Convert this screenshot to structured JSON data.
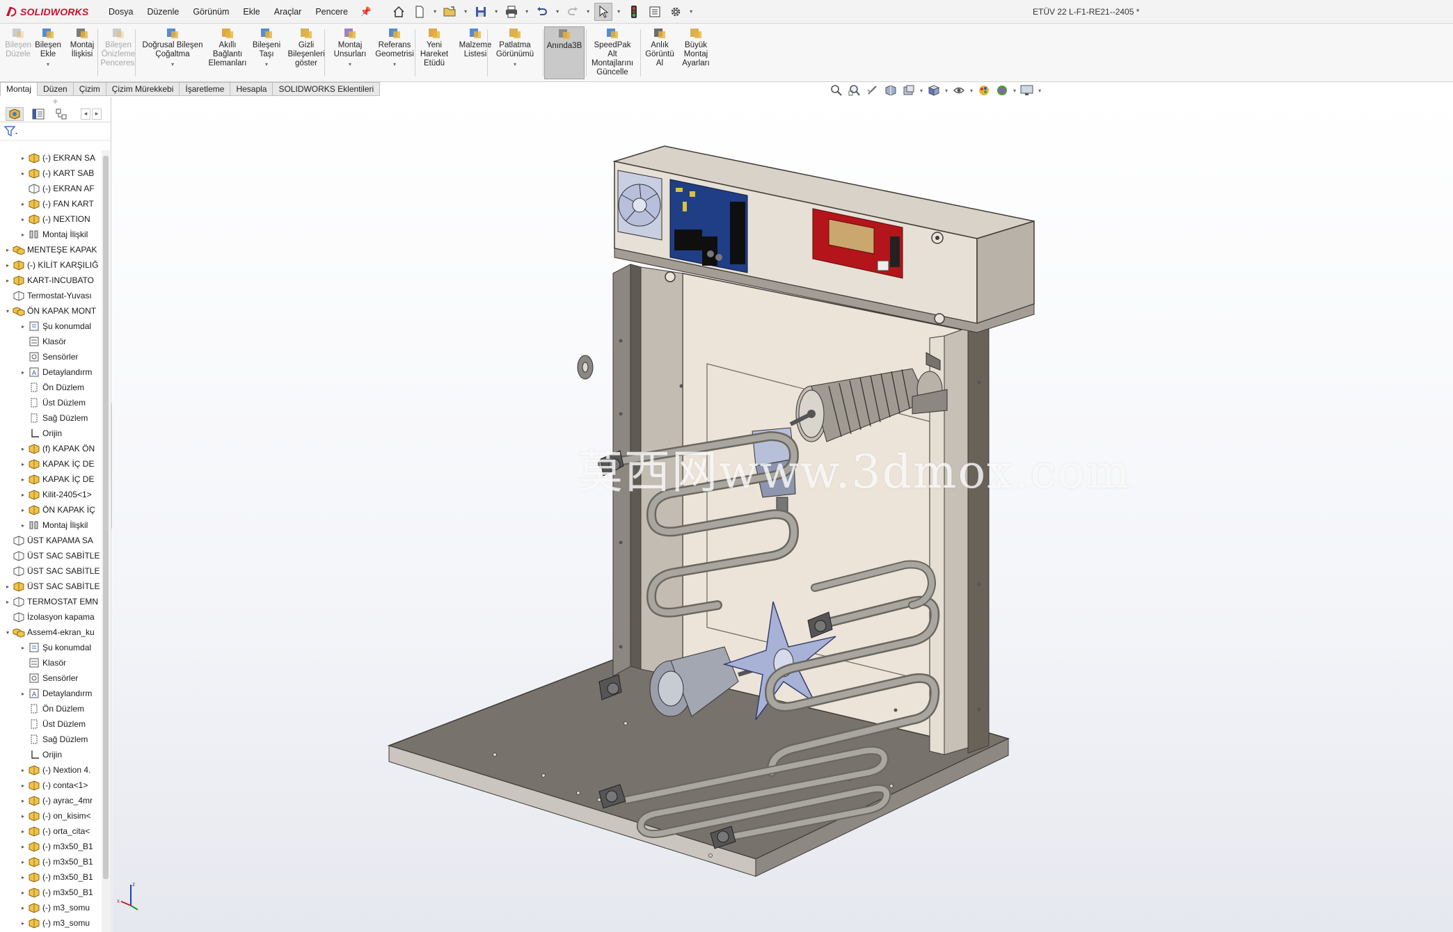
{
  "app": {
    "brand": "SOLIDWORKS",
    "document_title": "ETÜV 22 L-F1-RE21--2405 *"
  },
  "menu": [
    "Dosya",
    "Düzenle",
    "Görünüm",
    "Ekle",
    "Araçlar",
    "Pencere"
  ],
  "quick_toolbar": [
    "home-icon",
    "new-document-icon",
    "open-icon",
    "save-icon",
    "print-icon",
    "undo-icon",
    "redo-icon",
    "select-icon",
    "traffic-light-icon",
    "file-properties-icon",
    "options-gear-icon"
  ],
  "ribbon": {
    "buttons": [
      {
        "label": "Bileşen\nDüzele",
        "state": "disabled"
      },
      {
        "label": "Bileşen\nEkle",
        "state": "enabled",
        "dropdown": true
      },
      {
        "label": "Montaj\nİlişkisi",
        "state": "enabled"
      },
      {
        "label": "Bileşen\nÖnizleme\nPenceresi",
        "state": "disabled"
      },
      {
        "label": "Doğrusal Bileşen\nÇoğaltma",
        "state": "enabled",
        "dropdown": true
      },
      {
        "label": "Akıllı\nBağlantı\nElemanları",
        "state": "enabled"
      },
      {
        "label": "Bileşeni\nTaşı",
        "state": "enabled",
        "dropdown": true
      },
      {
        "label": "Gizli\nBileşenleri\ngöster",
        "state": "enabled"
      },
      {
        "label": "Montaj\nUnsurları",
        "state": "enabled",
        "dropdown": true
      },
      {
        "label": "Referans\nGeometrisi",
        "state": "enabled",
        "dropdown": true
      },
      {
        "label": "Yeni\nHareket\nEtüdü",
        "state": "enabled"
      },
      {
        "label": "Malzeme\nListesi",
        "state": "enabled"
      },
      {
        "label": "Patlatma\nGörünümü",
        "state": "enabled",
        "dropdown": true
      },
      {
        "label": "Anında3B",
        "state": "active"
      },
      {
        "label": "SpeedPak\nAlt\nMontajlarını\nGüncelle",
        "state": "enabled"
      },
      {
        "label": "Anlık\nGörüntü\nAl",
        "state": "enabled"
      },
      {
        "label": "Büyük\nMontaj\nAyarları",
        "state": "enabled"
      }
    ]
  },
  "tabs": [
    "Montaj",
    "Düzen",
    "Çizim",
    "Çizim Mürekkebi",
    "İşaretleme",
    "Hesapla",
    "SOLIDWORKS Eklentileri"
  ],
  "active_tab": "Montaj",
  "feature_tree": {
    "nodes": [
      {
        "label": "(-) EKRAN SA",
        "indent": 1,
        "expand": "collapsed",
        "icon": "part"
      },
      {
        "label": "(-) KART SAB",
        "indent": 1,
        "expand": "collapsed",
        "icon": "part"
      },
      {
        "label": "(-) EKRAN AF",
        "indent": 1,
        "expand": "none",
        "icon": "part-outline"
      },
      {
        "label": "(-) FAN KART",
        "indent": 1,
        "expand": "collapsed",
        "icon": "part"
      },
      {
        "label": "(-) NEXTION",
        "indent": 1,
        "expand": "collapsed",
        "icon": "part"
      },
      {
        "label": "Montaj İlişkil",
        "indent": 1,
        "expand": "collapsed",
        "icon": "mates"
      },
      {
        "label": "MENTEŞE KAPAK",
        "indent": 0,
        "expand": "collapsed",
        "icon": "assembly"
      },
      {
        "label": "(-) KİLİT KARŞILIĞ",
        "indent": 0,
        "expand": "collapsed",
        "icon": "part"
      },
      {
        "label": "KART-INCUBATO",
        "indent": 0,
        "expand": "collapsed",
        "icon": "part"
      },
      {
        "label": "Termostat-Yuvası",
        "indent": 0,
        "expand": "none",
        "icon": "part-outline"
      },
      {
        "label": "ÖN KAPAK MONT",
        "indent": 0,
        "expand": "expanded",
        "icon": "assembly"
      },
      {
        "label": "Şu konumdal",
        "indent": 1,
        "expand": "collapsed",
        "icon": "history"
      },
      {
        "label": "Klasör",
        "indent": 1,
        "expand": "none",
        "icon": "folder"
      },
      {
        "label": "Sensörler",
        "indent": 1,
        "expand": "none",
        "icon": "sensor"
      },
      {
        "label": "Detaylandırm",
        "indent": 1,
        "expand": "collapsed",
        "icon": "annotation"
      },
      {
        "label": "Ön Düzlem",
        "indent": 1,
        "expand": "none",
        "icon": "plane"
      },
      {
        "label": "Üst Düzlem",
        "indent": 1,
        "expand": "none",
        "icon": "plane"
      },
      {
        "label": "Sağ Düzlem",
        "indent": 1,
        "expand": "none",
        "icon": "plane"
      },
      {
        "label": "Orijin",
        "indent": 1,
        "expand": "none",
        "icon": "origin"
      },
      {
        "label": "(f) KAPAK ÖN",
        "indent": 1,
        "expand": "collapsed",
        "icon": "part"
      },
      {
        "label": "KAPAK İÇ DE",
        "indent": 1,
        "expand": "collapsed",
        "icon": "part"
      },
      {
        "label": "KAPAK İÇ DE",
        "indent": 1,
        "expand": "collapsed",
        "icon": "part"
      },
      {
        "label": "Kilit-2405<1>",
        "indent": 1,
        "expand": "collapsed",
        "icon": "part"
      },
      {
        "label": "ÖN KAPAK İÇ",
        "indent": 1,
        "expand": "collapsed",
        "icon": "part"
      },
      {
        "label": "Montaj İlişkil",
        "indent": 1,
        "expand": "collapsed",
        "icon": "mates"
      },
      {
        "label": "ÜST KAPAMA SA",
        "indent": 0,
        "expand": "none",
        "icon": "part-outline"
      },
      {
        "label": "ÜST SAC SABİTLE",
        "indent": 0,
        "expand": "none",
        "icon": "part-outline"
      },
      {
        "label": "ÜST SAC SABİTLE",
        "indent": 0,
        "expand": "none",
        "icon": "part-outline"
      },
      {
        "label": "ÜST SAC SABİTLE",
        "indent": 0,
        "expand": "collapsed",
        "icon": "part"
      },
      {
        "label": "TERMOSTAT EMN",
        "indent": 0,
        "expand": "collapsed",
        "icon": "part-outline"
      },
      {
        "label": "İzolasyon kapama",
        "indent": 0,
        "expand": "none",
        "icon": "part-outline"
      },
      {
        "label": "Assem4-ekran_ku",
        "indent": 0,
        "expand": "expanded",
        "icon": "assembly"
      },
      {
        "label": "Şu konumdal",
        "indent": 1,
        "expand": "collapsed",
        "icon": "history"
      },
      {
        "label": "Klasör",
        "indent": 1,
        "expand": "none",
        "icon": "folder"
      },
      {
        "label": "Sensörler",
        "indent": 1,
        "expand": "none",
        "icon": "sensor"
      },
      {
        "label": "Detaylandırm",
        "indent": 1,
        "expand": "collapsed",
        "icon": "annotation"
      },
      {
        "label": "Ön Düzlem",
        "indent": 1,
        "expand": "none",
        "icon": "plane"
      },
      {
        "label": "Üst Düzlem",
        "indent": 1,
        "expand": "none",
        "icon": "plane"
      },
      {
        "label": "Sağ Düzlem",
        "indent": 1,
        "expand": "none",
        "icon": "plane"
      },
      {
        "label": "Orijin",
        "indent": 1,
        "expand": "none",
        "icon": "origin"
      },
      {
        "label": "(-) Nextion 4.",
        "indent": 1,
        "expand": "collapsed",
        "icon": "part"
      },
      {
        "label": "(-) conta<1>",
        "indent": 1,
        "expand": "collapsed",
        "icon": "part"
      },
      {
        "label": "(-) ayrac_4mr",
        "indent": 1,
        "expand": "collapsed",
        "icon": "part"
      },
      {
        "label": "(-) on_kisim<",
        "indent": 1,
        "expand": "collapsed",
        "icon": "part"
      },
      {
        "label": "(-) orta_cita<",
        "indent": 1,
        "expand": "collapsed",
        "icon": "part"
      },
      {
        "label": "(-) m3x50_B1",
        "indent": 1,
        "expand": "collapsed",
        "icon": "part"
      },
      {
        "label": "(-) m3x50_B1",
        "indent": 1,
        "expand": "collapsed",
        "icon": "part"
      },
      {
        "label": "(-) m3x50_B1",
        "indent": 1,
        "expand": "collapsed",
        "icon": "part"
      },
      {
        "label": "(-) m3x50_B1",
        "indent": 1,
        "expand": "collapsed",
        "icon": "part"
      },
      {
        "label": "(-) m3_somu",
        "indent": 1,
        "expand": "collapsed",
        "icon": "part"
      },
      {
        "label": "(-) m3_somu",
        "indent": 1,
        "expand": "collapsed",
        "icon": "part"
      }
    ]
  },
  "heads_up_toolbar": [
    "zoom-to-fit-icon",
    "zoom-to-area-icon",
    "previous-view-icon",
    "section-view-icon",
    "dynamic-annotation-icon",
    "view-orientation-icon",
    "display-style-icon",
    "hide-show-items-icon",
    "edit-appearance-icon",
    "apply-scene-icon",
    "view-settings-icon"
  ],
  "viewport": {
    "watermark": "莫西网www.3dmox.com",
    "model_description_colors": {
      "housing": "#c8c4bd",
      "panel": "#e9e1d6",
      "base": "#6f6a64",
      "heater": "#8b8f98",
      "fan_blade": "#a7b2d6",
      "pcb_blue": "#1f3e86",
      "pcb_red": "#b3151b"
    }
  },
  "colors": {
    "brand_red": "#c8102e",
    "active_button": "#c9c9c9"
  }
}
